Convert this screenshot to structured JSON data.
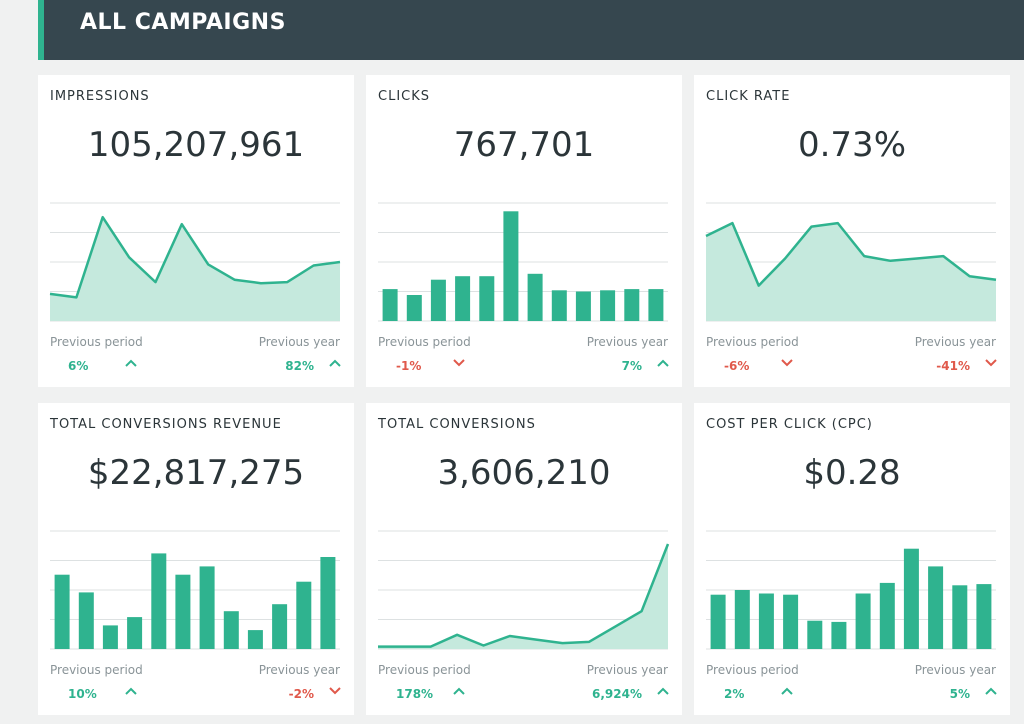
{
  "header": {
    "title": "ALL CAMPAIGNS"
  },
  "colors": {
    "accent": "#2fb38f",
    "positive": "#2fb38f",
    "negative": "#e0594b",
    "area_fill": "#c5e9dd",
    "grid": "#dde1e2"
  },
  "cards": [
    {
      "label": "IMPRESSIONS",
      "value": "105,207,961",
      "chart_type": "area",
      "points": [
        0.23,
        0.2,
        0.88,
        0.54,
        0.33,
        0.82,
        0.48,
        0.35,
        0.32,
        0.33,
        0.47,
        0.5
      ],
      "prev_period_label": "Previous period",
      "prev_period_value": "6%",
      "prev_period_trend": "up",
      "prev_year_label": "Previous year",
      "prev_year_value": "82%",
      "prev_year_trend": "up"
    },
    {
      "label": "CLICKS",
      "value": "767,701",
      "chart_type": "bar",
      "points": [
        0.27,
        0.22,
        0.35,
        0.38,
        0.38,
        0.93,
        0.4,
        0.26,
        0.25,
        0.26,
        0.27,
        0.27
      ],
      "prev_period_label": "Previous period",
      "prev_period_value": "-1%",
      "prev_period_trend": "down",
      "prev_year_label": "Previous year",
      "prev_year_value": "7%",
      "prev_year_trend": "up"
    },
    {
      "label": "CLICK RATE",
      "value": "0.73%",
      "chart_type": "area",
      "points": [
        0.72,
        0.83,
        0.3,
        0.53,
        0.8,
        0.83,
        0.55,
        0.51,
        0.53,
        0.55,
        0.38,
        0.35
      ],
      "prev_period_label": "Previous period",
      "prev_period_value": "-6%",
      "prev_period_trend": "down",
      "prev_year_label": "Previous year",
      "prev_year_value": "-41%",
      "prev_year_trend": "down"
    },
    {
      "label": "TOTAL CONVERSIONS REVENUE",
      "value": "$22,817,275",
      "chart_type": "bar",
      "points": [
        0.63,
        0.48,
        0.2,
        0.27,
        0.81,
        0.63,
        0.7,
        0.32,
        0.16,
        0.38,
        0.57,
        0.78
      ],
      "prev_period_label": "Previous period",
      "prev_period_value": "10%",
      "prev_period_trend": "up",
      "prev_year_label": "Previous year",
      "prev_year_value": "-2%",
      "prev_year_trend": "down"
    },
    {
      "label": "TOTAL CONVERSIONS",
      "value": "3,606,210",
      "chart_type": "area",
      "points": [
        0.02,
        0.02,
        0.02,
        0.12,
        0.03,
        0.11,
        0.08,
        0.05,
        0.06,
        0.19,
        0.32,
        0.89
      ],
      "prev_period_label": "Previous period",
      "prev_period_value": "178%",
      "prev_period_trend": "up",
      "prev_year_label": "Previous year",
      "prev_year_value": "6,924%",
      "prev_year_trend": "up"
    },
    {
      "label": "COST PER CLICK (CPC)",
      "value": "$0.28",
      "chart_type": "bar",
      "points": [
        0.46,
        0.5,
        0.47,
        0.46,
        0.24,
        0.23,
        0.47,
        0.56,
        0.85,
        0.7,
        0.54,
        0.55
      ],
      "prev_period_label": "Previous period",
      "prev_period_value": "2%",
      "prev_period_trend": "up",
      "prev_year_label": "Previous year",
      "prev_year_value": "5%",
      "prev_year_trend": "up"
    }
  ]
}
